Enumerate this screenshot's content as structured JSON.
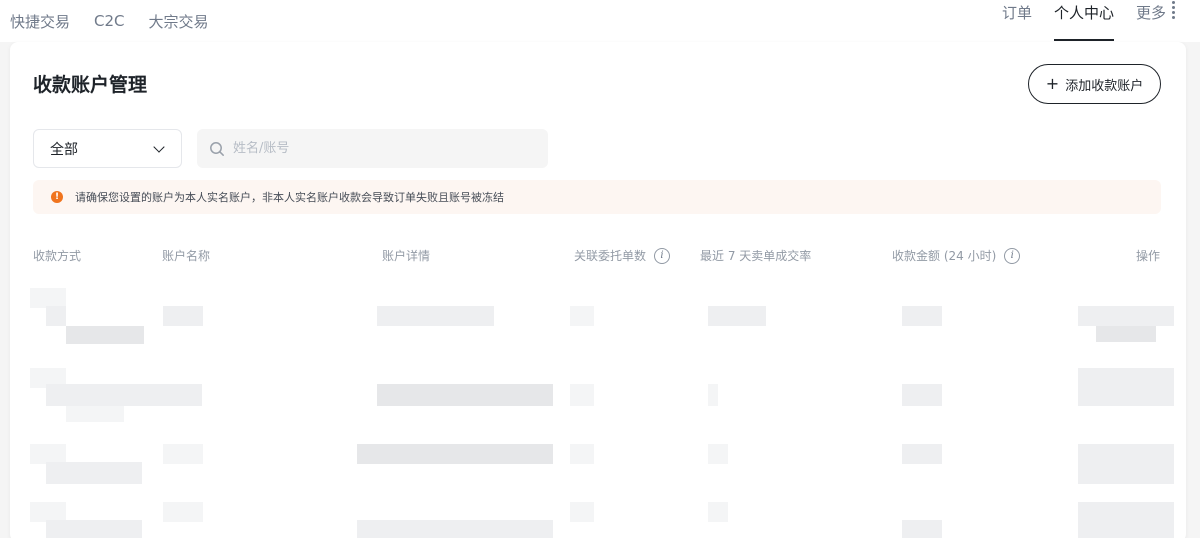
{
  "nav": {
    "left": [
      "快捷交易",
      "C2C",
      "大宗交易"
    ],
    "right": {
      "orders": "订单",
      "profile": "个人中心",
      "more": "更多"
    }
  },
  "page": {
    "title": "收款账户管理",
    "add_button": "添加收款账户",
    "filter_value": "全部",
    "search_placeholder": "姓名/账号",
    "notice": "请确保您设置的账户为本人实名账户，非本人实名账户收款会导致订单失败且账号被冻结"
  },
  "table": {
    "columns": [
      "收款方式",
      "账户名称",
      "账户详情",
      "关联委托单数",
      "最近 7 天卖单成交率",
      "收款金额 (24 小时)",
      "操作"
    ]
  },
  "colors": {
    "text_primary": "#1e2329",
    "text_secondary": "#707a8a",
    "warning": "#f0741e",
    "notification_dot": "#f6465d"
  }
}
